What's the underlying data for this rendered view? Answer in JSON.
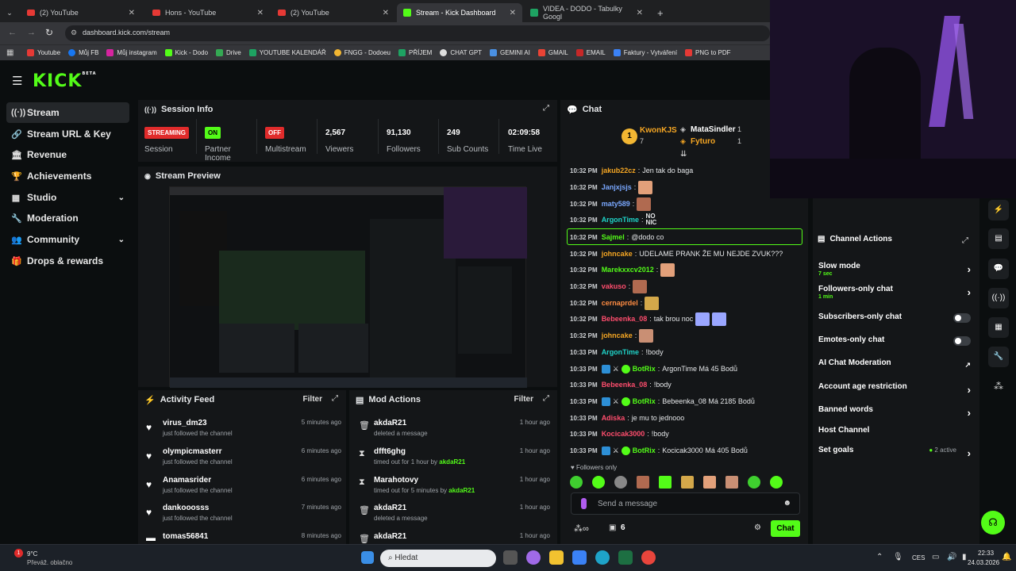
{
  "browser": {
    "tabs": [
      {
        "title": "(2) YouTube",
        "icon": "youtube-icon"
      },
      {
        "title": "Hons - YouTube",
        "icon": "youtube-icon"
      },
      {
        "title": "(2) YouTube",
        "icon": "youtube-icon"
      },
      {
        "title": "Stream - Kick Dashboard",
        "icon": "kick-icon",
        "active": true
      },
      {
        "title": "VIDEA - DODO - Tabulky Googl",
        "icon": "sheets-icon"
      }
    ],
    "url": "dashboard.kick.com/stream",
    "bookmarks": [
      "Youtube",
      "Můj FB",
      "Můj instagram",
      "Kick - Dodo",
      "Drive",
      "YOUTUBE KALENDÁŘ",
      "FNGG - Dodoeu",
      "PŘÍJEM",
      "CHAT GPT",
      "GEMINI AI",
      "GMAIL",
      "EMAIL",
      "Faktury - Vytváření",
      "PNG to PDF"
    ]
  },
  "logo": {
    "text": "KICK",
    "beta": "BETA"
  },
  "sidebar": {
    "items": [
      {
        "label": "Stream",
        "icon": "signal-icon",
        "active": true
      },
      {
        "label": "Stream URL & Key",
        "icon": "link-icon"
      },
      {
        "label": "Revenue",
        "icon": "bank-icon"
      },
      {
        "label": "Achievements",
        "icon": "trophy-icon"
      },
      {
        "label": "Studio",
        "icon": "grid-icon",
        "expandable": true
      },
      {
        "label": "Moderation",
        "icon": "wrench-icon"
      },
      {
        "label": "Community",
        "icon": "people-icon",
        "expandable": true
      },
      {
        "label": "Drops & rewards",
        "icon": "gift-icon"
      }
    ]
  },
  "session": {
    "title": "Session Info",
    "stats": [
      {
        "value": "STREAMING",
        "label": "Session"
      },
      {
        "value": "ON",
        "label": "Partner Income"
      },
      {
        "value": "OFF",
        "label": "Multistream"
      },
      {
        "value": "2,567",
        "label": "Viewers"
      },
      {
        "value": "91,130",
        "label": "Followers"
      },
      {
        "value": "249",
        "label": "Sub Counts"
      },
      {
        "value": "02:09:58",
        "label": "Time Live"
      }
    ]
  },
  "preview": {
    "title": "Stream Preview"
  },
  "activity": {
    "title": "Activity Feed",
    "filter": "Filter",
    "items": [
      {
        "name": "virus_dm23",
        "sub": "just followed the channel",
        "time": "5 minutes ago"
      },
      {
        "name": "olympicmasterr",
        "sub": "just followed the channel",
        "time": "6 minutes ago"
      },
      {
        "name": "Anamasrider",
        "sub": "just followed the channel",
        "time": "6 minutes ago"
      },
      {
        "name": "dankooosss",
        "sub": "just followed the channel",
        "time": "7 minutes ago"
      },
      {
        "name": "tomas56841",
        "sub": "",
        "time": "8 minutes ago"
      }
    ]
  },
  "mod": {
    "title": "Mod Actions",
    "filter": "Filter",
    "items": [
      {
        "name": "akdaR21",
        "sub": "deleted a message",
        "by": "",
        "time": "1 hour ago",
        "icon": "trash-icon"
      },
      {
        "name": "dfft6ghg",
        "sub": "timed out for 1 hour by",
        "by": "akdaR21",
        "time": "1 hour ago",
        "icon": "hourglass-icon"
      },
      {
        "name": "Marahotovy",
        "sub": "timed out for 5 minutes by",
        "by": "akdaR21",
        "time": "1 hour ago",
        "icon": "hourglass-icon"
      },
      {
        "name": "akdaR21",
        "sub": "deleted a message",
        "by": "",
        "time": "1 hour ago",
        "icon": "trash-icon"
      },
      {
        "name": "akdaR21",
        "sub": "",
        "by": "",
        "time": "1 hour ago",
        "icon": "trash-icon"
      }
    ]
  },
  "chat": {
    "title": "Chat",
    "top_gifters": [
      {
        "name": "KwonKJS",
        "count": "7",
        "rank": "1"
      },
      {
        "name": "MataSindler",
        "count": "1"
      },
      {
        "name": "Fyturo",
        "count": "1"
      }
    ],
    "messages": [
      {
        "time": "10:32 PM",
        "user": "jakub22cz",
        "color": "#f5a623",
        "text": "Jen tak do baga",
        "emote": false,
        "bot": false
      },
      {
        "time": "10:32 PM",
        "user": "Janjxjsjs",
        "color": "#7aa8ff",
        "text": "",
        "emote": true,
        "bot": false
      },
      {
        "time": "10:32 PM",
        "user": "maty589",
        "color": "#7aa8ff",
        "text": "",
        "emote": true,
        "bot": false
      },
      {
        "time": "10:32 PM",
        "user": "ArgonTime",
        "color": "#1fd3c8",
        "text": "NO NIC",
        "emote": false,
        "bot": false
      },
      {
        "time": "10:32 PM",
        "user": "Sajmel",
        "color": "#53fc18",
        "text": "@dodo co",
        "emote": false,
        "bot": false,
        "highlight": true
      },
      {
        "time": "10:32 PM",
        "user": "johncake",
        "color": "#f5a623",
        "text": "UDELAME PRANK ŽE MU NEJDE ZVUK???",
        "emote": false,
        "bot": false
      },
      {
        "time": "10:32 PM",
        "user": "Marekxxcv2012",
        "color": "#53fc18",
        "text": "",
        "emote": true,
        "bot": false
      },
      {
        "time": "10:32 PM",
        "user": "vakuso",
        "color": "#ff4d6d",
        "text": "",
        "emote": true,
        "bot": false
      },
      {
        "time": "10:32 PM",
        "user": "cernaprdel",
        "color": "#ff8c42",
        "text": "",
        "emote": true,
        "bot": false
      },
      {
        "time": "10:32 PM",
        "user": "Bebeenka_08",
        "color": "#ff4d6d",
        "text": "tak brou noc",
        "emote": true,
        "bot": false
      },
      {
        "time": "10:32 PM",
        "user": "johncake",
        "color": "#f5a623",
        "text": "",
        "emote": true,
        "bot": false
      },
      {
        "time": "10:33 PM",
        "user": "ArgonTime",
        "color": "#1fd3c8",
        "text": "!body",
        "emote": false,
        "bot": false
      },
      {
        "time": "10:33 PM",
        "user": "BotRix",
        "color": "#53fc18",
        "text": "ArgonTime Má 45 Bodů",
        "emote": false,
        "bot": true
      },
      {
        "time": "10:33 PM",
        "user": "Bebeenka_08",
        "color": "#ff4d6d",
        "text": "!body",
        "emote": false,
        "bot": false
      },
      {
        "time": "10:33 PM",
        "user": "BotRix",
        "color": "#53fc18",
        "text": "Bebeenka_08 Má 2185 Bodů",
        "emote": false,
        "bot": true
      },
      {
        "time": "10:33 PM",
        "user": "Adiska",
        "color": "#ff4d6d",
        "text": "je mu to jednooo",
        "emote": false,
        "bot": false
      },
      {
        "time": "10:33 PM",
        "user": "Kocicak3000",
        "color": "#ff4d6d",
        "text": "!body",
        "emote": false,
        "bot": false
      },
      {
        "time": "10:33 PM",
        "user": "BotRix",
        "color": "#53fc18",
        "text": "Kocicak3000 Má 405 Bodů",
        "emote": false,
        "bot": true
      }
    ],
    "followers_only": "Followers only",
    "placeholder": "Send a message",
    "count": "6",
    "send_label": "Chat"
  },
  "channel_actions": {
    "title": "Channel Actions",
    "items": [
      {
        "label": "Slow mode",
        "sub": "7 sec",
        "control": "chevron"
      },
      {
        "label": "Followers-only chat",
        "sub": "1 min",
        "control": "chevron"
      },
      {
        "label": "Subscribers-only chat",
        "sub": "",
        "control": "toggle"
      },
      {
        "label": "Emotes-only chat",
        "sub": "",
        "control": "toggle"
      },
      {
        "label": "AI Chat Moderation",
        "sub": "",
        "control": "external"
      },
      {
        "label": "Account age restriction",
        "sub": "",
        "control": "chevron"
      },
      {
        "label": "Banned words",
        "sub": "",
        "control": "chevron"
      },
      {
        "label": "Host Channel",
        "sub": "",
        "control": "none"
      },
      {
        "label": "Set goals",
        "sub": "",
        "control": "chevron",
        "status": "2 active"
      }
    ]
  },
  "taskbar": {
    "weather_temp": "9°C",
    "weather_desc": "Převáž. oblačno",
    "search": "Hledat",
    "lang": "CES",
    "time": "22:33",
    "date": "24.03.2026",
    "notif_count": "1"
  },
  "colors": {
    "accent": "#53fc18",
    "bg": "#0b0e0f",
    "panel": "#141618",
    "red": "#e02b2b"
  }
}
